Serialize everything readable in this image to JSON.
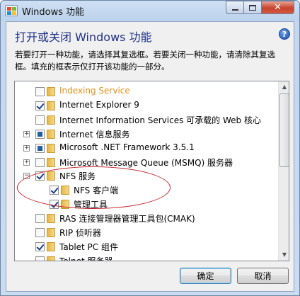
{
  "window": {
    "title": "Windows 功能",
    "close_glyph": "✕"
  },
  "heading": "打开或关闭 Windows 功能",
  "help_glyph": "?",
  "description": "若要打开一种功能，请选择其复选框。若要关闭一种功能，请清除其复选框。填充的框表示仅打开该功能的一部分。",
  "features": [
    {
      "label": "Indexing Service",
      "state": "unchecked",
      "expander": "",
      "highlight": true
    },
    {
      "label": "Internet Explorer 9",
      "state": "checked",
      "expander": ""
    },
    {
      "label": "Internet Information Services 可承载的 Web 核心",
      "state": "unchecked",
      "expander": ""
    },
    {
      "label": "Internet 信息服务",
      "state": "partial",
      "expander": "+"
    },
    {
      "label": "Microsoft .NET Framework 3.5.1",
      "state": "partial",
      "expander": "+"
    },
    {
      "label": "Microsoft Message Queue (MSMQ) 服务器",
      "state": "unchecked",
      "expander": "+"
    },
    {
      "label": "NFS 服务",
      "state": "checked",
      "expander": "−"
    },
    {
      "label": "NFS 客户端",
      "state": "checked",
      "expander": "",
      "child": true
    },
    {
      "label": "管理工具",
      "state": "checked",
      "expander": "",
      "child": true
    },
    {
      "label": "RAS 连接管理器管理工具包(CMAK)",
      "state": "unchecked",
      "expander": ""
    },
    {
      "label": "RIP 侦听器",
      "state": "unchecked",
      "expander": ""
    },
    {
      "label": "Tablet PC 组件",
      "state": "checked",
      "expander": ""
    },
    {
      "label": "Telnet 服务器",
      "state": "unchecked",
      "expander": ""
    }
  ],
  "buttons": {
    "ok": "确定",
    "cancel": "取消"
  }
}
